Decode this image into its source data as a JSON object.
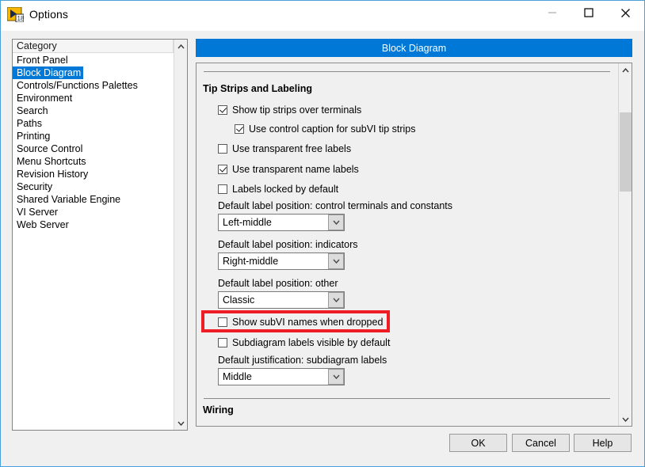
{
  "window": {
    "title": "Options",
    "icon": "labview-options-icon",
    "controls": {
      "minimize": "minimize-icon",
      "maximize": "maximize-icon",
      "close": "close-icon"
    }
  },
  "category_list": {
    "header": "Category",
    "selected": "Block Diagram",
    "items": [
      "Front Panel",
      "Block Diagram",
      "Controls/Functions Palettes",
      "Environment",
      "Search",
      "Paths",
      "Printing",
      "Source Control",
      "Menu Shortcuts",
      "Revision History",
      "Security",
      "Shared Variable Engine",
      "VI Server",
      "Web Server"
    ]
  },
  "banner": {
    "title": "Block Diagram",
    "color": "#0078d7"
  },
  "content": {
    "sections": [
      {
        "title": "Tip Strips and Labeling",
        "checkboxes": [
          {
            "label": "Show tip strips over terminals",
            "checked": true,
            "indent": 0
          },
          {
            "label": "Use control caption for subVI tip strips",
            "checked": true,
            "indent": 1
          },
          {
            "label": "Use transparent free labels",
            "checked": false,
            "indent": 0
          },
          {
            "label": "Use transparent name labels",
            "checked": true,
            "indent": 0
          },
          {
            "label": "Labels locked by default",
            "checked": false,
            "indent": 0
          }
        ],
        "fields": [
          {
            "label": "Default label position: control terminals and constants",
            "value": "Left-middle"
          },
          {
            "label": "Default label position: indicators",
            "value": "Right-middle"
          },
          {
            "label": "Default label position: other",
            "value": "Classic"
          }
        ],
        "checkboxes2": [
          {
            "label": "Show subVI names when dropped",
            "checked": false,
            "highlighted": true
          },
          {
            "label": "Subdiagram labels visible by default",
            "checked": false,
            "highlighted": false
          }
        ],
        "fields2": [
          {
            "label": "Default justification: subdiagram labels",
            "value": "Middle"
          }
        ]
      },
      {
        "title": "Wiring"
      }
    ],
    "highlight_color": "#ee1c25"
  },
  "buttons": {
    "ok": "OK",
    "cancel": "Cancel",
    "help": "Help"
  }
}
